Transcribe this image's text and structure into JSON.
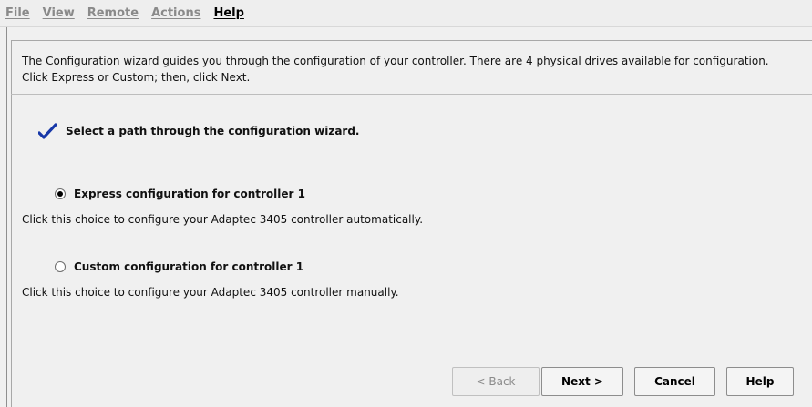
{
  "menu": {
    "file": "File",
    "view": "View",
    "remote": "Remote",
    "actions": "Actions",
    "help": "Help"
  },
  "wizard": {
    "intro": "The Configuration wizard guides you through the configuration of your controller. There are 4 physical drives available for configuration. Click Express or Custom; then, click Next.",
    "step_title": "Select a path through the configuration wizard.",
    "options": [
      {
        "label": "Express configuration for controller 1",
        "description": "Click this choice to configure your Adaptec 3405 controller automatically.",
        "selected": true
      },
      {
        "label": "Custom configuration for controller 1",
        "description": "Click this choice to configure your Adaptec 3405 controller manually.",
        "selected": false
      }
    ]
  },
  "buttons": {
    "back": "< Back",
    "next": "Next >",
    "cancel": "Cancel",
    "help": "Help"
  }
}
